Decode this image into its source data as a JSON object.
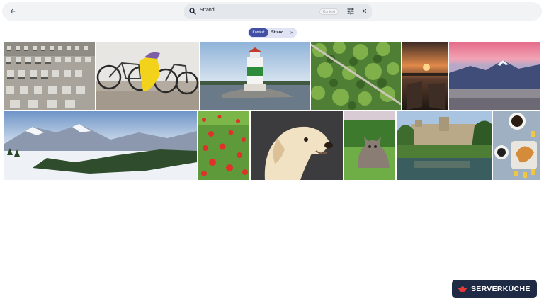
{
  "search": {
    "value": "Strand",
    "context_tag": "Kontext"
  },
  "filter_chip": {
    "type_label": "Kontext",
    "value": "Strand"
  },
  "icons": {
    "back": "arrow-left-icon",
    "search": "search-icon",
    "filter": "tune-icon",
    "clear": "close-icon",
    "chip_remove": "close-icon"
  },
  "gallery": {
    "rows": [
      [
        {
          "subject": "beach-chairs"
        },
        {
          "subject": "bicycles"
        },
        {
          "subject": "lighthouse"
        },
        {
          "subject": "forest-aerial"
        },
        {
          "subject": "harbor-sunset"
        },
        {
          "subject": "mountains-pink-sky"
        }
      ],
      [
        {
          "subject": "snowy-mountains"
        },
        {
          "subject": "poppy-field"
        },
        {
          "subject": "golden-retriever"
        },
        {
          "subject": "cat-in-grass"
        },
        {
          "subject": "castle-river"
        },
        {
          "subject": "breakfast-table"
        }
      ]
    ]
  },
  "brand": {
    "name": "SERVERKÜCHE",
    "color": "#1f2a44",
    "logo_color": "#e53935"
  },
  "colors": {
    "accent": "#4150a5",
    "chip_bg": "#dfe3f3",
    "topbar_bg": "#f1f3f5",
    "searchbox_bg": "#e4e7eb"
  }
}
